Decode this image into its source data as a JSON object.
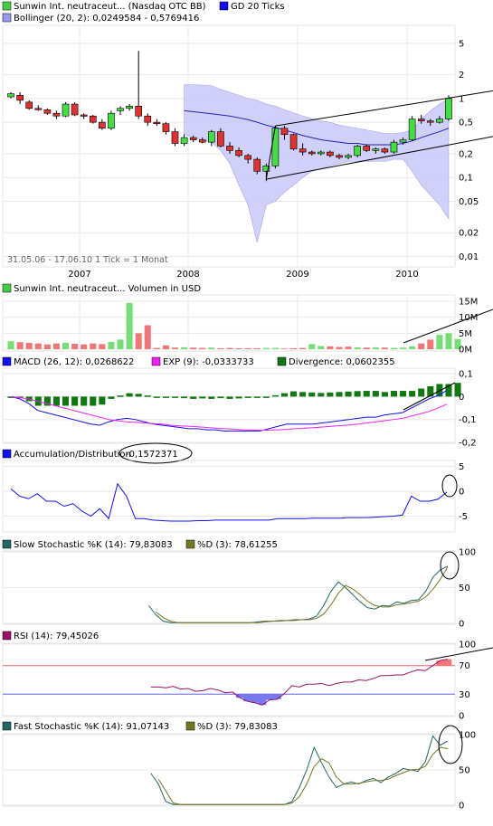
{
  "main": {
    "legend": [
      {
        "text": "Sunwin Int. neutraceut... (Nasdaq OTC BB)",
        "color": "#44cc44"
      },
      {
        "text": "GD 20 Ticks",
        "color": "#1111ee"
      },
      {
        "text": "Bollinger (20, 2): 0,0249584 - 0,5769416",
        "color": "#9999ee"
      }
    ],
    "y_ticks": [
      "5",
      "2",
      "1",
      "0,5",
      "0,2",
      "0,1",
      "0,05",
      "0,02",
      "0,01"
    ],
    "x_ticks": [
      "2007",
      "2008",
      "2009",
      "2010"
    ],
    "footnote": "31.05.06 - 17.06.10   1 Tick = 1 Monat",
    "colors": {
      "up": "#44dd44",
      "down": "#dd3333",
      "band": "#c8c8f8",
      "band_line": "#9999ee",
      "ma": "#2222bb"
    }
  },
  "volume": {
    "legend": "Sunwin Int. neutraceut... Volumen in USD",
    "legend_color": "#44cc44",
    "y_ticks": [
      "15M",
      "10M",
      "5M",
      "0M"
    ]
  },
  "macd": {
    "legend": [
      {
        "text": "MACD (26, 12): 0,0268622",
        "color": "#1111ee"
      },
      {
        "text": "EXP (9): -0,0333733",
        "color": "#ee22ee"
      },
      {
        "text": "Divergence: 0,0602355",
        "color": "#117711"
      }
    ],
    "y_ticks": [
      "0,1",
      "0",
      "-0,1",
      "-0,2"
    ]
  },
  "ad": {
    "legend": "Accumulation/Distribution",
    "value": "-0,1572371",
    "legend_color": "#1111ee",
    "y_ticks": [
      "5",
      "0",
      "-5"
    ]
  },
  "slow_stoch": {
    "legend": [
      {
        "text": "Slow Stochastic %K (14): 79,83083",
        "color": "#226666"
      },
      {
        "text": "%D (3): 78,61255",
        "color": "#777722"
      }
    ],
    "y_ticks": [
      "100",
      "50",
      "0"
    ]
  },
  "rsi": {
    "legend": "RSI (14): 79,45026",
    "legend_color": "#991166",
    "y_ticks": [
      "100",
      "70",
      "30",
      "0"
    ]
  },
  "fast_stoch": {
    "legend": [
      {
        "text": "Fast Stochastic %K (14): 91,07143",
        "color": "#226666"
      },
      {
        "text": "%D (3): 79,83083",
        "color": "#777722"
      }
    ],
    "y_ticks": [
      "100",
      "50",
      "0"
    ]
  },
  "chart_data": [
    {
      "type": "candlestick",
      "title": "Sunwin Int. neutraceut... (Nasdaq OTC BB)",
      "y_scale": "log",
      "ylim": [
        0.008,
        8
      ],
      "x_labels": [
        "2007",
        "2008",
        "2009",
        "2010"
      ],
      "period": "31.05.06 - 17.06.10",
      "interval": "1 Monat",
      "candles": [
        {
          "o": 1.05,
          "h": 1.2,
          "l": 1.0,
          "c": 1.15
        },
        {
          "o": 1.1,
          "h": 1.2,
          "l": 0.85,
          "c": 0.95
        },
        {
          "o": 0.9,
          "h": 0.95,
          "l": 0.72,
          "c": 0.75
        },
        {
          "o": 0.75,
          "h": 0.82,
          "l": 0.7,
          "c": 0.72
        },
        {
          "o": 0.72,
          "h": 0.75,
          "l": 0.62,
          "c": 0.65
        },
        {
          "o": 0.65,
          "h": 0.7,
          "l": 0.55,
          "c": 0.6
        },
        {
          "o": 0.6,
          "h": 0.9,
          "l": 0.58,
          "c": 0.85
        },
        {
          "o": 0.85,
          "h": 0.9,
          "l": 0.6,
          "c": 0.62
        },
        {
          "o": 0.62,
          "h": 0.65,
          "l": 0.55,
          "c": 0.6
        },
        {
          "o": 0.6,
          "h": 0.62,
          "l": 0.48,
          "c": 0.5
        },
        {
          "o": 0.5,
          "h": 0.55,
          "l": 0.4,
          "c": 0.42
        },
        {
          "o": 0.42,
          "h": 0.7,
          "l": 0.4,
          "c": 0.65
        },
        {
          "o": 0.7,
          "h": 0.8,
          "l": 0.62,
          "c": 0.75
        },
        {
          "o": 0.75,
          "h": 0.85,
          "l": 0.7,
          "c": 0.8
        },
        {
          "o": 0.8,
          "h": 4.0,
          "l": 0.55,
          "c": 0.6
        },
        {
          "o": 0.6,
          "h": 0.65,
          "l": 0.45,
          "c": 0.5
        },
        {
          "o": 0.5,
          "h": 0.55,
          "l": 0.45,
          "c": 0.48
        },
        {
          "o": 0.48,
          "h": 0.5,
          "l": 0.35,
          "c": 0.38
        },
        {
          "o": 0.38,
          "h": 0.42,
          "l": 0.25,
          "c": 0.27
        },
        {
          "o": 0.27,
          "h": 0.35,
          "l": 0.25,
          "c": 0.32
        },
        {
          "o": 0.32,
          "h": 0.34,
          "l": 0.28,
          "c": 0.3
        },
        {
          "o": 0.3,
          "h": 0.32,
          "l": 0.27,
          "c": 0.28
        },
        {
          "o": 0.28,
          "h": 0.4,
          "l": 0.25,
          "c": 0.38
        },
        {
          "o": 0.38,
          "h": 0.42,
          "l": 0.24,
          "c": 0.25
        },
        {
          "o": 0.25,
          "h": 0.28,
          "l": 0.2,
          "c": 0.22
        },
        {
          "o": 0.22,
          "h": 0.24,
          "l": 0.18,
          "c": 0.19
        },
        {
          "o": 0.19,
          "h": 0.2,
          "l": 0.15,
          "c": 0.17
        },
        {
          "o": 0.17,
          "h": 0.18,
          "l": 0.11,
          "c": 0.12
        },
        {
          "o": 0.12,
          "h": 0.15,
          "l": 0.09,
          "c": 0.14
        },
        {
          "o": 0.14,
          "h": 0.45,
          "l": 0.13,
          "c": 0.42
        },
        {
          "o": 0.42,
          "h": 0.45,
          "l": 0.3,
          "c": 0.35
        },
        {
          "o": 0.35,
          "h": 0.36,
          "l": 0.22,
          "c": 0.23
        },
        {
          "o": 0.23,
          "h": 0.27,
          "l": 0.19,
          "c": 0.21
        },
        {
          "o": 0.21,
          "h": 0.22,
          "l": 0.19,
          "c": 0.2
        },
        {
          "o": 0.2,
          "h": 0.22,
          "l": 0.19,
          "c": 0.21
        },
        {
          "o": 0.21,
          "h": 0.22,
          "l": 0.18,
          "c": 0.19
        },
        {
          "o": 0.19,
          "h": 0.2,
          "l": 0.17,
          "c": 0.18
        },
        {
          "o": 0.18,
          "h": 0.2,
          "l": 0.17,
          "c": 0.19
        },
        {
          "o": 0.19,
          "h": 0.26,
          "l": 0.18,
          "c": 0.25
        },
        {
          "o": 0.25,
          "h": 0.26,
          "l": 0.21,
          "c": 0.22
        },
        {
          "o": 0.22,
          "h": 0.24,
          "l": 0.2,
          "c": 0.23
        },
        {
          "o": 0.23,
          "h": 0.24,
          "l": 0.2,
          "c": 0.21
        },
        {
          "o": 0.21,
          "h": 0.3,
          "l": 0.2,
          "c": 0.28
        },
        {
          "o": 0.28,
          "h": 0.32,
          "l": 0.26,
          "c": 0.3
        },
        {
          "o": 0.3,
          "h": 0.6,
          "l": 0.29,
          "c": 0.55
        },
        {
          "o": 0.55,
          "h": 0.62,
          "l": 0.48,
          "c": 0.52
        },
        {
          "o": 0.52,
          "h": 0.55,
          "l": 0.45,
          "c": 0.5
        },
        {
          "o": 0.5,
          "h": 0.6,
          "l": 0.48,
          "c": 0.55
        },
        {
          "o": 0.55,
          "h": 1.1,
          "l": 0.52,
          "c": 1.0
        }
      ],
      "ma20": [
        null,
        null,
        null,
        null,
        null,
        null,
        null,
        null,
        null,
        null,
        null,
        null,
        null,
        null,
        null,
        null,
        null,
        null,
        null,
        0.7,
        0.68,
        0.66,
        0.64,
        0.62,
        0.6,
        0.57,
        0.54,
        0.5,
        0.46,
        0.43,
        0.4,
        0.37,
        0.34,
        0.32,
        0.3,
        0.29,
        0.28,
        0.27,
        0.27,
        0.26,
        0.26,
        0.26,
        0.26,
        0.27,
        0.29,
        0.32,
        0.35,
        0.38,
        0.42
      ],
      "bb_upper": [
        null,
        null,
        null,
        null,
        null,
        null,
        null,
        null,
        null,
        null,
        null,
        null,
        null,
        null,
        null,
        null,
        null,
        null,
        null,
        1.5,
        1.5,
        1.48,
        1.45,
        1.3,
        1.2,
        1.1,
        1.0,
        0.95,
        0.85,
        0.8,
        0.72,
        0.66,
        0.6,
        0.56,
        0.52,
        0.5,
        0.46,
        0.44,
        0.42,
        0.4,
        0.38,
        0.36,
        0.36,
        0.37,
        0.4,
        0.55,
        0.7,
        0.85,
        1.0
      ],
      "bb_lower": [
        null,
        null,
        null,
        null,
        null,
        null,
        null,
        null,
        null,
        null,
        null,
        null,
        null,
        null,
        null,
        null,
        null,
        null,
        null,
        0.35,
        0.32,
        0.3,
        0.28,
        0.22,
        0.15,
        0.08,
        0.045,
        0.015,
        0.045,
        0.05,
        0.065,
        0.08,
        0.1,
        0.12,
        0.13,
        0.14,
        0.15,
        0.16,
        0.16,
        0.16,
        0.16,
        0.16,
        0.17,
        0.17,
        0.12,
        0.08,
        0.06,
        0.045,
        0.03
      ]
    },
    {
      "type": "bar",
      "title": "Sunwin Int. neutraceut... Volumen in USD",
      "unit": "M USD",
      "ylim": [
        0,
        17
      ],
      "values": [
        2.5,
        2.2,
        2.0,
        1.8,
        1.5,
        1.8,
        2.0,
        1.7,
        1.5,
        1.8,
        1.6,
        2.3,
        3.0,
        14.5,
        5.0,
        7.5,
        0.4,
        1.2,
        0.5,
        0.6,
        0.5,
        0.4,
        0.5,
        0.3,
        0.4,
        0.3,
        0.3,
        0.3,
        0.4,
        0.4,
        0.2,
        0.3,
        0.4,
        1.6,
        1.0,
        0.9,
        0.7,
        0.8,
        0.6,
        0.5,
        0.6,
        0.5,
        0.4,
        0.5,
        0.9,
        1.8,
        3.0,
        4.5,
        5.0,
        3.2
      ],
      "up": [
        true,
        false,
        false,
        false,
        false,
        false,
        true,
        false,
        false,
        false,
        false,
        true,
        true,
        true,
        false,
        false,
        false,
        false,
        false,
        true,
        false,
        false,
        true,
        false,
        false,
        false,
        false,
        false,
        true,
        true,
        false,
        false,
        false,
        true,
        true,
        false,
        false,
        false,
        true,
        false,
        true,
        false,
        true,
        true,
        true,
        false,
        false,
        true,
        true,
        true
      ]
    },
    {
      "type": "line+bar",
      "title": "MACD (26, 12)",
      "ylim": [
        -0.2,
        0.12
      ],
      "macd": [
        0,
        -0.01,
        -0.03,
        -0.06,
        -0.07,
        -0.08,
        -0.09,
        -0.1,
        -0.11,
        -0.12,
        -0.125,
        -0.11,
        -0.1,
        -0.095,
        -0.1,
        -0.11,
        -0.12,
        -0.125,
        -0.13,
        -0.135,
        -0.14,
        -0.14,
        -0.145,
        -0.145,
        -0.15,
        -0.15,
        -0.15,
        -0.15,
        -0.15,
        -0.14,
        -0.13,
        -0.12,
        -0.12,
        -0.12,
        -0.12,
        -0.115,
        -0.11,
        -0.105,
        -0.1,
        -0.095,
        -0.09,
        -0.09,
        -0.08,
        -0.075,
        -0.07,
        -0.05,
        -0.03,
        -0.01,
        0.005,
        0.027
      ],
      "signal": [
        0,
        -0.005,
        -0.01,
        -0.02,
        -0.03,
        -0.04,
        -0.05,
        -0.06,
        -0.07,
        -0.08,
        -0.09,
        -0.1,
        -0.105,
        -0.11,
        -0.112,
        -0.115,
        -0.118,
        -0.12,
        -0.125,
        -0.128,
        -0.13,
        -0.132,
        -0.135,
        -0.138,
        -0.14,
        -0.142,
        -0.145,
        -0.146,
        -0.147,
        -0.146,
        -0.145,
        -0.143,
        -0.14,
        -0.138,
        -0.136,
        -0.133,
        -0.13,
        -0.127,
        -0.124,
        -0.12,
        -0.115,
        -0.11,
        -0.105,
        -0.1,
        -0.095,
        -0.085,
        -0.075,
        -0.065,
        -0.05,
        -0.033
      ],
      "divergence": [
        0,
        -0.005,
        -0.02,
        -0.04,
        -0.04,
        -0.04,
        -0.04,
        -0.04,
        -0.04,
        -0.04,
        -0.035,
        -0.01,
        0.005,
        0.015,
        0.012,
        0.005,
        -0.002,
        -0.005,
        -0.005,
        -0.007,
        -0.01,
        -0.008,
        -0.01,
        -0.007,
        -0.01,
        -0.008,
        -0.005,
        -0.004,
        -0.003,
        0.006,
        0.015,
        0.023,
        0.02,
        0.018,
        0.016,
        0.018,
        0.02,
        0.022,
        0.024,
        0.025,
        0.025,
        0.02,
        0.025,
        0.025,
        0.025,
        0.035,
        0.045,
        0.055,
        0.055,
        0.06
      ]
    },
    {
      "type": "line",
      "title": "Accumulation/Distribution",
      "ylim": [
        -8,
        6
      ],
      "values": [
        0.5,
        -1,
        -1.5,
        -0.5,
        -2,
        -2,
        -3,
        -2.5,
        -4,
        -5,
        -3.5,
        -5.5,
        1.5,
        -1,
        -5.5,
        -5.5,
        -5.8,
        -5.9,
        -6,
        -6,
        -6,
        -5.9,
        -5.9,
        -5.8,
        -5.8,
        -5.8,
        -5.8,
        -5.8,
        -5.8,
        -5.8,
        -5.5,
        -5.5,
        -5.5,
        -5.5,
        -5.4,
        -5.4,
        -5.4,
        -5.4,
        -5.3,
        -5.3,
        -5.3,
        -5.2,
        -5.1,
        -5,
        -4.8,
        -1,
        -2,
        -2,
        -1.6,
        -0.16
      ]
    },
    {
      "type": "line",
      "title": "Slow Stochastic %K (14)",
      "ylim": [
        0,
        100
      ],
      "k": [
        null,
        null,
        null,
        null,
        null,
        null,
        null,
        null,
        null,
        null,
        null,
        null,
        null,
        null,
        null,
        null,
        null,
        null,
        null,
        25,
        12,
        3,
        1,
        1,
        1,
        1,
        1,
        1,
        1,
        1,
        1,
        1,
        1,
        1,
        2,
        3,
        3,
        4,
        4,
        5,
        5,
        6,
        10,
        25,
        45,
        58,
        50,
        40,
        30,
        22,
        20,
        25,
        24,
        30,
        28,
        32,
        33,
        45,
        65,
        75,
        80
      ],
      "d": [
        null,
        null,
        null,
        null,
        null,
        null,
        null,
        null,
        null,
        null,
        null,
        null,
        null,
        null,
        null,
        null,
        null,
        null,
        null,
        null,
        16,
        8,
        3,
        1,
        1,
        1,
        1,
        1,
        1,
        1,
        1,
        1,
        1,
        1,
        1,
        2,
        3,
        3,
        4,
        4,
        5,
        5,
        7,
        13,
        26,
        42,
        53,
        48,
        40,
        31,
        25,
        23,
        23,
        26,
        27,
        29,
        31,
        37,
        48,
        62,
        79
      ]
    },
    {
      "type": "line",
      "title": "RSI (14)",
      "ylim": [
        0,
        100
      ],
      "levels": [
        70,
        30
      ],
      "values": [
        null,
        null,
        null,
        null,
        null,
        null,
        null,
        null,
        null,
        null,
        null,
        null,
        null,
        null,
        null,
        null,
        null,
        null,
        null,
        40,
        40,
        39,
        41,
        37,
        38,
        34,
        35,
        38,
        36,
        32,
        33,
        25,
        20,
        18,
        15,
        22,
        23,
        31,
        42,
        40,
        44,
        44,
        45,
        42,
        45,
        47,
        47,
        50,
        49,
        52,
        56,
        56,
        57,
        57,
        61,
        64,
        63,
        70,
        77,
        79
      ]
    },
    {
      "type": "line",
      "title": "Fast Stochastic %K (14)",
      "ylim": [
        0,
        100
      ],
      "k": [
        null,
        null,
        null,
        null,
        null,
        null,
        null,
        null,
        null,
        null,
        null,
        null,
        null,
        null,
        null,
        null,
        null,
        null,
        null,
        45,
        30,
        5,
        1,
        1,
        1,
        1,
        1,
        1,
        1,
        1,
        1,
        1,
        1,
        1,
        1,
        1,
        1,
        1,
        5,
        25,
        50,
        82,
        60,
        40,
        25,
        30,
        33,
        30,
        35,
        38,
        32,
        40,
        45,
        52,
        50,
        48,
        62,
        98,
        85,
        91
      ],
      "d": [
        null,
        null,
        null,
        null,
        null,
        null,
        null,
        null,
        null,
        null,
        null,
        null,
        null,
        null,
        null,
        null,
        null,
        null,
        null,
        null,
        37,
        20,
        3,
        1,
        1,
        1,
        1,
        1,
        1,
        1,
        1,
        1,
        1,
        1,
        1,
        1,
        1,
        1,
        3,
        12,
        30,
        55,
        66,
        60,
        40,
        30,
        30,
        31,
        33,
        35,
        35,
        37,
        42,
        46,
        50,
        51,
        55,
        72,
        82,
        80
      ]
    }
  ]
}
